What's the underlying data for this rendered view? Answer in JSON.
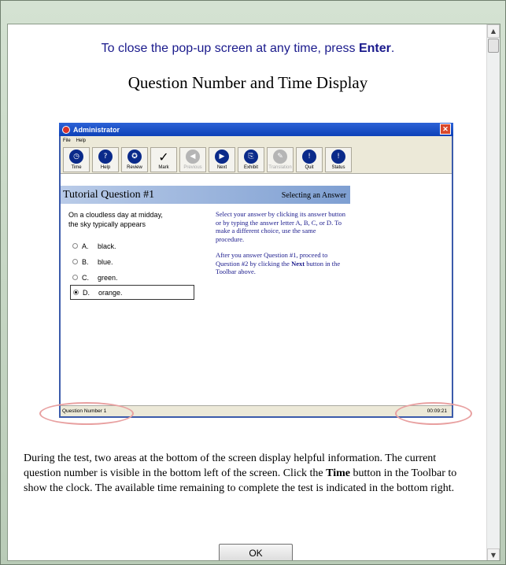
{
  "dialog": {
    "close_msg_prefix": "To close the pop-up screen at any time, press ",
    "close_msg_key": "Enter",
    "close_msg_suffix": ".",
    "title": "Question Number and Time Display",
    "ok_label": "OK"
  },
  "screenshot": {
    "window_title": "Administrator",
    "close_glyph": "✕",
    "menu": [
      "File",
      "Help"
    ],
    "toolbar": [
      {
        "label": "Time",
        "icon": "clock-icon",
        "glyph": "◷",
        "enabled": true
      },
      {
        "label": "Help",
        "icon": "help-icon",
        "glyph": "?",
        "enabled": true
      },
      {
        "label": "Review",
        "icon": "review-icon",
        "glyph": "✪",
        "enabled": true
      },
      {
        "label": "Mark",
        "icon": "checkmark-icon",
        "glyph": "✓",
        "enabled": true
      },
      {
        "label": "Previous",
        "icon": "previous-icon",
        "glyph": "◀",
        "enabled": false
      },
      {
        "label": "Next",
        "icon": "next-icon",
        "glyph": "▶",
        "enabled": true
      },
      {
        "label": "Exhibit",
        "icon": "exhibit-icon",
        "glyph": "⎘",
        "enabled": true
      },
      {
        "label": "Translation",
        "icon": "translation-icon",
        "glyph": "✎",
        "enabled": false
      },
      {
        "label": "Quit",
        "icon": "quit-icon",
        "glyph": "!",
        "enabled": true
      },
      {
        "label": "Status",
        "icon": "status-icon",
        "glyph": "!",
        "enabled": true
      }
    ],
    "question_title": "Tutorial Question #1",
    "question_subtitle": "Selecting an Answer",
    "stem_line1": "On a cloudless day at midday,",
    "stem_line2": "the sky typically appears",
    "choices": [
      {
        "letter": "A.",
        "text": "black.",
        "selected": false
      },
      {
        "letter": "B.",
        "text": "blue.",
        "selected": false
      },
      {
        "letter": "C.",
        "text": "green.",
        "selected": false
      },
      {
        "letter": "D.",
        "text": "orange.",
        "selected": true
      }
    ],
    "instruction1": "Select your answer by clicking its answer button or by typing the answer letter A, B, C, or D. To make a different choice, use the same procedure.",
    "instruction2_before": "After you answer Question #1, proceed to Question #2 by clicking the ",
    "instruction2_bold": "Next",
    "instruction2_after": " button in the Toolbar above.",
    "status_left": "Question Number 1",
    "status_right": "00:09:21"
  },
  "body": {
    "part1": "During the test, two areas at the bottom of the screen display helpful information. The current question number is visible in the bottom left of the screen. Click the ",
    "bold": "Time",
    "part2": " button in the Toolbar to show the clock. The available time remaining to complete the test is indicated in the bottom right."
  },
  "colors": {
    "title_bar": "#0d41b8",
    "instruction_text": "#1a1a8c",
    "highlight_ellipse": "#e8a0a0"
  }
}
